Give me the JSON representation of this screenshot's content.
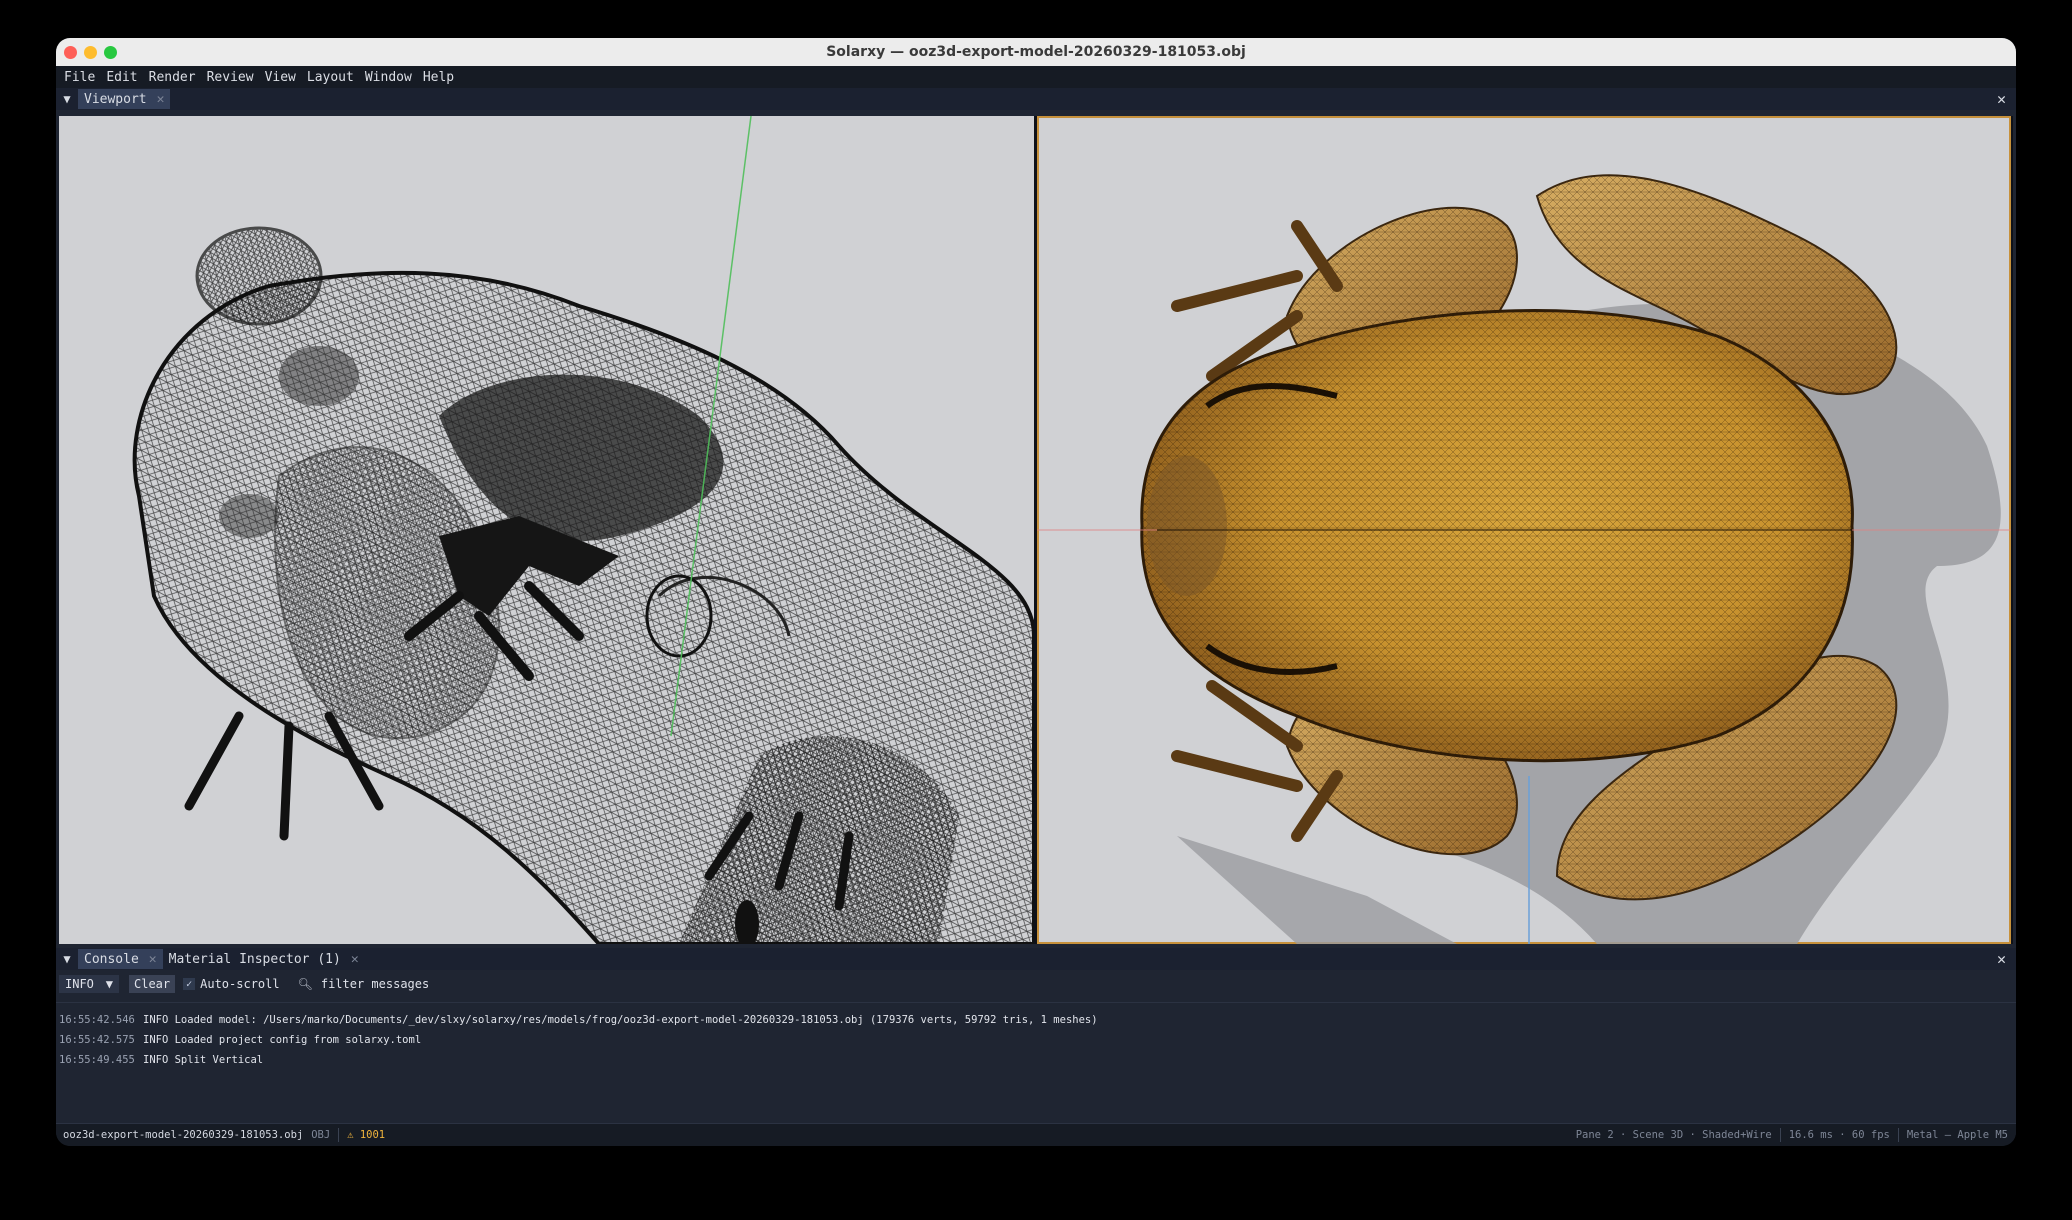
{
  "window": {
    "title": "Solarxy — ooz3d-export-model-20260329-181053.obj"
  },
  "menu": [
    "File",
    "Edit",
    "Render",
    "Review",
    "View",
    "Layout",
    "Window",
    "Help"
  ],
  "viewport_panel": {
    "tab_label": "Viewport"
  },
  "bottom_panel": {
    "tabs": [
      "Console",
      "Material Inspector (1)"
    ]
  },
  "console": {
    "level": "INFO",
    "clear_label": "Clear",
    "autoscroll_label": "Auto-scroll",
    "autoscroll_checked": true,
    "filter_placeholder": "filter messages",
    "logs": [
      {
        "time": "16:55:42.546",
        "message": "INFO Loaded model: /Users/marko/Documents/_dev/slxy/solarxy/res/models/frog/ooz3d-export-model-20260329-181053.obj (179376 verts, 59792 tris, 1 meshes)"
      },
      {
        "time": "16:55:42.575",
        "message": "INFO Loaded project config from solarxy.toml"
      },
      {
        "time": "16:55:49.455",
        "message": "INFO Split Vertical"
      }
    ]
  },
  "statusbar": {
    "file": "ooz3d-export-model-20260329-181053.obj",
    "type": "OBJ",
    "warnings": "⚠ 1001",
    "pane": "Pane 2 · Scene 3D · Shaded+Wire",
    "timing": "16.6 ms · 60 fps",
    "renderer": "Metal — Apple M5"
  },
  "colors": {
    "accent_border": "#c7913b",
    "warning": "#f0b43c",
    "panel_bg": "#1f2532",
    "viewport_bg": "#d0d1d4"
  }
}
